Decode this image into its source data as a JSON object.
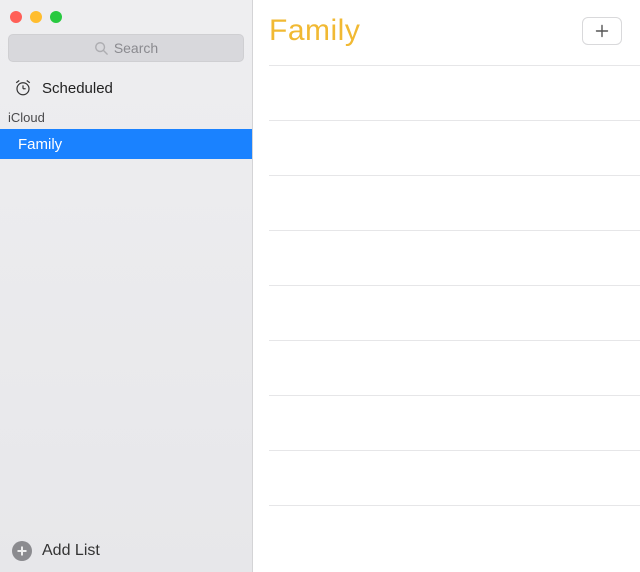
{
  "search": {
    "placeholder": "Search"
  },
  "sidebar": {
    "scheduled_label": "Scheduled",
    "sections": [
      {
        "title": "iCloud",
        "lists": [
          {
            "name": "Family",
            "selected": true
          }
        ]
      }
    ],
    "add_list_label": "Add List"
  },
  "main": {
    "title": "Family"
  },
  "colors": {
    "accent": "#f1b933",
    "selection": "#1a82ff"
  }
}
